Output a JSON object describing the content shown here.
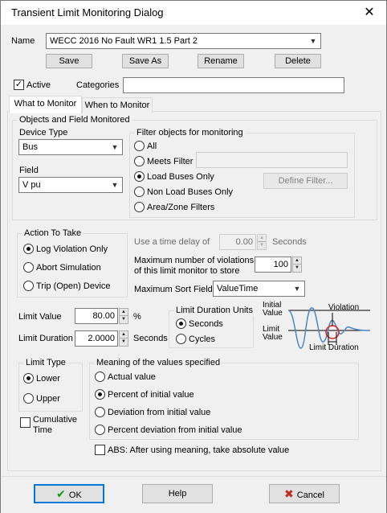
{
  "window": {
    "title": "Transient Limit Monitoring Dialog"
  },
  "name_row": {
    "label": "Name",
    "value": "WECC 2016 No Fault WR1 1.5 Part 2",
    "buttons": {
      "save": "Save",
      "save_as": "Save As",
      "rename": "Rename",
      "delete": "Delete"
    }
  },
  "active": {
    "label": "Active",
    "checked": true
  },
  "categories": {
    "label": "Categories",
    "value": ""
  },
  "tabs": [
    {
      "label": "What to Monitor",
      "active": true
    },
    {
      "label": "When to Monitor",
      "active": false
    }
  ],
  "objects_group": {
    "title": "Objects and Field Monitored",
    "device_type_label": "Device Type",
    "device_type_value": "Bus",
    "field_label": "Field",
    "field_value": "V pu"
  },
  "filter_group": {
    "title": "Filter objects for monitoring",
    "options": [
      "All",
      "Meets Filter",
      "Load Buses Only",
      "Non Load Buses Only",
      "Area/Zone Filters"
    ],
    "selected": "Load Buses Only",
    "define_filter_label": "Define Filter..."
  },
  "action_group": {
    "title": "Action To Take",
    "options": [
      "Log Violation Only",
      "Abort Simulation",
      "Trip (Open) Device"
    ],
    "selected": "Log Violation Only"
  },
  "delay": {
    "label": "Use a time delay of",
    "value": "0.00",
    "unit": "Seconds"
  },
  "max_violations": {
    "label_line1": "Maximum number of violations",
    "label_line2": "of this limit monitor to store",
    "value": "100"
  },
  "sort_field": {
    "label": "Maximum Sort Field",
    "value": "ValueTime"
  },
  "limit_value": {
    "label": "Limit Value",
    "value": "80.00",
    "unit": "%"
  },
  "limit_duration": {
    "label": "Limit Duration",
    "value": "2.0000",
    "unit": "Seconds"
  },
  "duration_units": {
    "title": "Limit Duration Units",
    "options": [
      "Seconds",
      "Cycles"
    ],
    "selected": "Seconds"
  },
  "diagram": {
    "initial_value": "Initial\nValue",
    "limit_value": "Limit\nValue",
    "violation": "Violation",
    "limit_duration": "Limit Duration"
  },
  "limit_type": {
    "title": "Limit Type",
    "options": [
      "Lower",
      "Upper"
    ],
    "selected": "Lower"
  },
  "cumulative_time": {
    "label_line1": "Cumulative",
    "label_line2": "Time",
    "checked": false
  },
  "meaning_group": {
    "title": "Meaning of the values specified",
    "options": [
      "Actual value",
      "Percent of initial value",
      "Deviation from initial value",
      "Percent deviation from initial value"
    ],
    "selected": "Percent of initial value"
  },
  "abs_option": {
    "label": "ABS: After using meaning, take absolute value",
    "checked": false
  },
  "footer": {
    "ok": "OK",
    "help": "Help",
    "cancel": "Cancel"
  },
  "colors": {
    "ok_check": "#1a9a1a",
    "cancel_x": "#c42b1c",
    "accent": "#0078d7",
    "diagram_curve": "#4a86c5",
    "violation_circle": "#e02020"
  }
}
